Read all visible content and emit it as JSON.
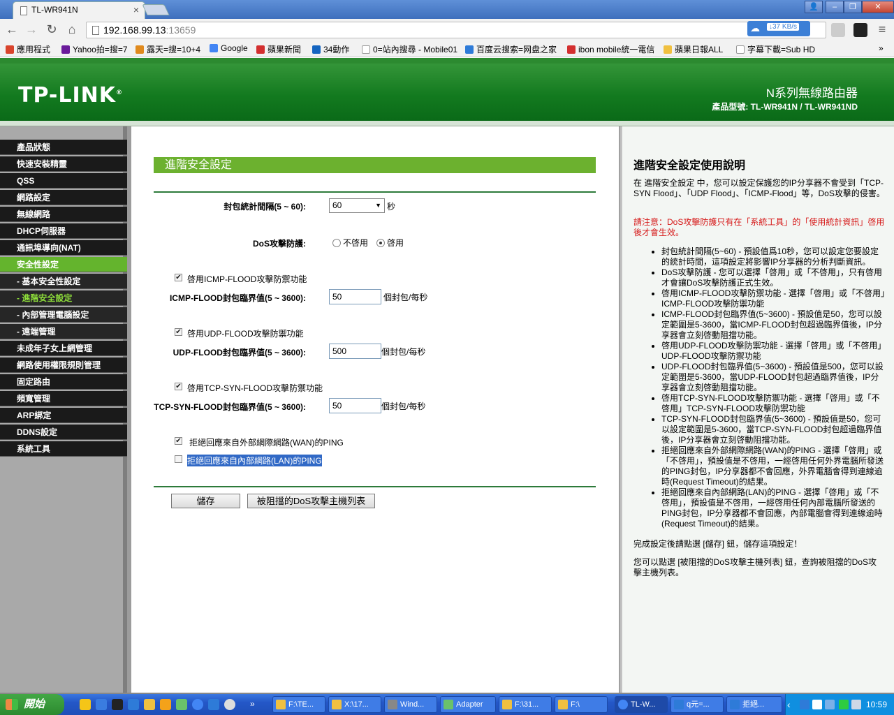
{
  "browser": {
    "tab_title": "TL-WR941N",
    "tab_close": "×",
    "url_host": "192.168.99.13",
    "url_port": ":13659",
    "speed": "↓37 KB/s",
    "win_min": "–",
    "win_max": "❐",
    "win_close": "✕",
    "user": "👤",
    "nav_back": "←",
    "nav_forward": "→",
    "nav_reload": "↻",
    "nav_home": "⌂",
    "menu": "≡",
    "bookmarks_more": "»",
    "bookmarks": [
      {
        "label": "應用程式",
        "color": "#d9442c"
      },
      {
        "label": "Yahoo拍=搜=7",
        "color": "#6a1b9a"
      },
      {
        "label": "露天=搜=10+4",
        "color": "#e08a1e"
      },
      {
        "label": "Google",
        "color": "#4285f4"
      },
      {
        "label": "蘋果新聞",
        "color": "#d32f2f"
      },
      {
        "label": "34動作",
        "color": "#1565c0"
      },
      {
        "label": "0=站內搜尋 - Mobile01",
        "color": "#bbbbbb"
      },
      {
        "label": "百度云搜索=网盘之家",
        "color": "#2e7bd8"
      },
      {
        "label": "ibon mobile統一電信",
        "color": "#d32f2f"
      },
      {
        "label": "蘋果日報ALL",
        "color": "#f0c040"
      },
      {
        "label": "字幕下載=Sub HD",
        "color": "#bbbbbb"
      }
    ]
  },
  "router": {
    "logo": "TP-LINK",
    "logo_mark": "®",
    "product_line": "N系列無線路由器",
    "product_model": "產品型號: TL-WR941N / TL-WR941ND"
  },
  "sidebar": {
    "items": [
      {
        "label": "產品狀態",
        "type": "main"
      },
      {
        "label": "快速安裝精靈",
        "type": "main"
      },
      {
        "label": "QSS",
        "type": "main"
      },
      {
        "label": "網路設定",
        "type": "main"
      },
      {
        "label": "無線網路",
        "type": "main"
      },
      {
        "label": "DHCP伺服器",
        "type": "main"
      },
      {
        "label": "通訊埠導向(NAT)",
        "type": "main"
      },
      {
        "label": "安全性設定",
        "type": "active"
      },
      {
        "label": "- 基本安全性設定",
        "type": "sub"
      },
      {
        "label": "- 進階安全設定",
        "type": "current"
      },
      {
        "label": "- 內部管理電腦設定",
        "type": "sub"
      },
      {
        "label": "- 遠端管理",
        "type": "sub"
      },
      {
        "label": "未成年子女上網管理",
        "type": "main"
      },
      {
        "label": "網路使用權限規則管理",
        "type": "main"
      },
      {
        "label": "固定路由",
        "type": "main"
      },
      {
        "label": "頻寬管理",
        "type": "main"
      },
      {
        "label": "ARP綁定",
        "type": "main"
      },
      {
        "label": "DDNS設定",
        "type": "main"
      },
      {
        "label": "系統工具",
        "type": "main"
      }
    ]
  },
  "form": {
    "title": "進階安全設定",
    "interval_label": "封包統計間隔(5 ~ 60):",
    "interval_value": "60",
    "interval_unit": "秒",
    "dos_label": "DoS攻擊防護:",
    "dos_off": "不啓用",
    "dos_on": "啓用",
    "icmp_enable": "啓用ICMP-FLOOD攻擊防禦功能",
    "icmp_label": "ICMP-FLOOD封包臨界值(5 ~ 3600):",
    "icmp_value": "50",
    "icmp_unit": "個封包/每秒",
    "udp_enable": "啓用UDP-FLOOD攻擊防禦功能",
    "udp_label": "UDP-FLOOD封包臨界值(5 ~ 3600):",
    "udp_value": "500",
    "udp_unit": "個封包/每秒",
    "tcp_enable": "啓用TCP-SYN-FLOOD攻擊防禦功能",
    "tcp_label": "TCP-SYN-FLOOD封包臨界值(5 ~ 3600):",
    "tcp_value": "50",
    "tcp_unit": "個封包/每秒",
    "wan_ping": "拒絕回應來自外部網際網路(WAN)的PING",
    "lan_ping": "拒絕回應來自內部網路(LAN)的PING",
    "save_button": "儲存",
    "blocked_button": "被阻擋的DoS攻擊主機列表"
  },
  "help": {
    "title": "進階安全設定使用說明",
    "intro": "在 進階安全設定 中，您可以設定保護您的IP分享器不會受到「TCP-SYN Flood」、「UDP Flood」、「ICMP-Flood」等，DoS攻擊的侵害。",
    "note": "請注意：DoS攻擊防護只有在「系統工具」的「使用統計資訊」啓用後才會生效。",
    "items": [
      "封包統計間隔(5~60) - 預設值爲10秒，您可以設定您要設定的統計時間，這項設定將影響IP分享器的分析判斷資訊。",
      "DoS攻擊防護 - 您可以選擇「啓用」或「不啓用」，只有啓用才會讓DoS攻擊防護正式生效。",
      "啓用ICMP-FLOOD攻擊防禦功能 - 選擇「啓用」或「不啓用」ICMP-FLOOD攻擊防禦功能",
      "ICMP-FLOOD封包臨界值(5~3600) - 預設值是50，您可以設定範圍是5-3600，當ICMP-FLOOD封包超過臨界值後，IP分享器會立刻啓動阻擋功能。",
      "啓用UDP-FLOOD攻擊防禦功能 - 選擇「啓用」或「不啓用」UDP-FLOOD攻擊防禦功能",
      "UDP-FLOOD封包臨界值(5~3600) - 預設值是500，您可以設定範圍是5-3600，當UDP-FLOOD封包超過臨界值後，IP分享器會立刻啓動阻擋功能。",
      "啓用TCP-SYN-FLOOD攻擊防禦功能 - 選擇「啓用」或「不啓用」TCP-SYN-FLOOD攻擊防禦功能",
      "TCP-SYN-FLOOD封包臨界值(5~3600) - 預設值是50，您可以設定範圍是5-3600，當TCP-SYN-FLOOD封包超過臨界值後，IP分享器會立刻啓動阻擋功能。",
      "拒絕回應來自外部網際網路(WAN)的PING - 選擇「啓用」或「不啓用」，預設值是不啓用，一經啓用任何外界電腦所發送的PING封包，IP分享器都不會回應，外界電腦會得到連線逾時(Request Timeout)的結果。",
      "拒絕回應來自內部網路(LAN)的PING - 選擇「啓用」或「不啓用」，預設值是不啓用，一經啓用任何內部電腦所發送的PING封包，IP分享器都不會回應，內部電腦會得到連線逾時(Request Timeout)的結果。"
    ],
    "save_hint": "完成設定後請點選 [儲存] 鈕，儲存這項設定！",
    "blocked_hint": "您可以點選 [被阻擋的DoS攻擊主機列表] 鈕，查詢被阻擋的DoS攻擊主機列表。"
  },
  "taskbar": {
    "start": "開始",
    "more": "»",
    "tasks": [
      {
        "label": "F:\\TE...",
        "color": "#f0c040"
      },
      {
        "label": "X:\\17...",
        "color": "#f0c040"
      },
      {
        "label": "Wind...",
        "color": "#888888"
      },
      {
        "label": "Adapter",
        "color": "#6ac26a"
      },
      {
        "label": "F:\\31...",
        "color": "#f0c040"
      },
      {
        "label": "F:\\",
        "color": "#f0c040"
      },
      {
        "label": "TL-W...",
        "color": "#4285f4"
      },
      {
        "label": "q元=...",
        "color": "#2e7bd8"
      },
      {
        "label": "拒絕...",
        "color": "#2e7bd8"
      }
    ],
    "tray_collapse": "‹",
    "clock": "10:59"
  },
  "colors": {
    "router_green": "#137a1f",
    "menu_active": "#64b42d",
    "section_bar": "#6cb12f",
    "note_red": "#d61818"
  }
}
